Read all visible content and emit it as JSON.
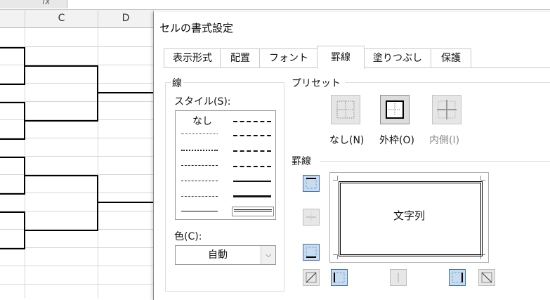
{
  "sheet": {
    "formula_bar_label": "fx",
    "columns": [
      "C",
      "D"
    ]
  },
  "dialog": {
    "title": "セルの書式設定",
    "tabs": [
      {
        "label": "表示形式",
        "active": false
      },
      {
        "label": "配置",
        "active": false
      },
      {
        "label": "フォント",
        "active": false
      },
      {
        "label": "罫線",
        "active": true
      },
      {
        "label": "塗りつぶし",
        "active": false
      },
      {
        "label": "保護",
        "active": false
      }
    ],
    "line": {
      "group_label": "線",
      "style_label": "スタイル(S):",
      "styles_left": [
        "なし",
        "hair",
        "dotted",
        "dash-dot-dot-thin",
        "dash-dot-thin",
        "dashed-thin",
        "solid-thin"
      ],
      "styles_right": [
        "medium-dash-dot-dot",
        "slant-dash-dot",
        "medium-dash-dot",
        "medium-dashed",
        "medium",
        "thick",
        "double"
      ],
      "color_label": "色(C):",
      "color_value": "自動"
    },
    "presets": {
      "group_label": "プリセット",
      "items": [
        {
          "label": "なし(N)",
          "icon": "preset-none-icon",
          "enabled": true
        },
        {
          "label": "外枠(O)",
          "icon": "preset-outline-icon",
          "enabled": true
        },
        {
          "label": "内側(I)",
          "icon": "preset-inside-icon",
          "enabled": false
        }
      ]
    },
    "border": {
      "group_label": "罫線",
      "preview_text": "文字列"
    }
  }
}
